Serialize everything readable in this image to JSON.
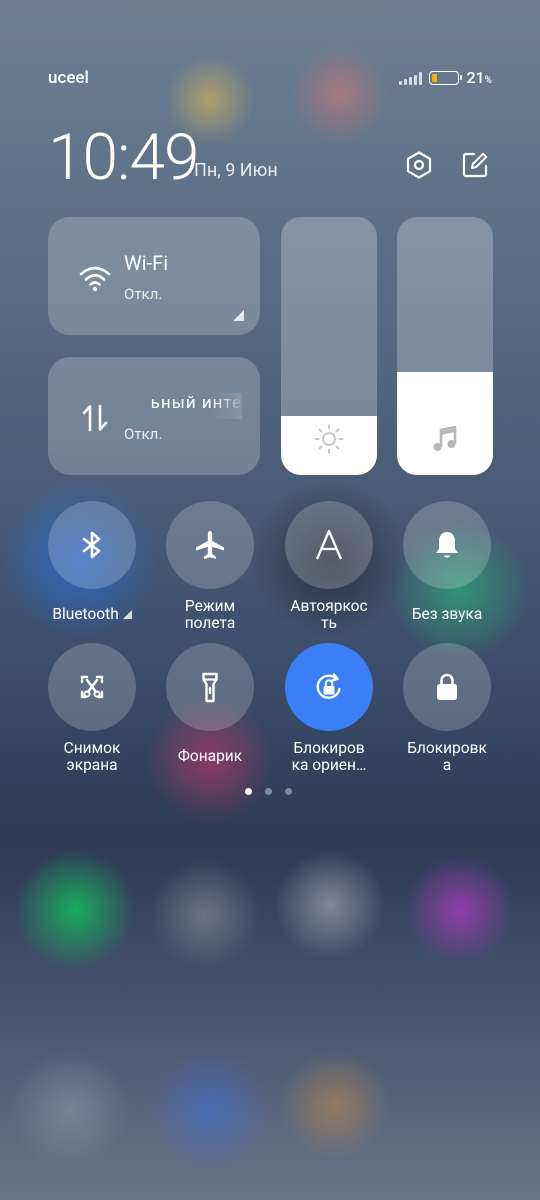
{
  "status_bar": {
    "carrier": "uceel",
    "battery_percent": "21",
    "battery_unit": "%",
    "battery_level": 0.21,
    "battery_color": "#f5b400"
  },
  "header": {
    "time": "10:49",
    "date": "Пн, 9 Июн",
    "icons": [
      "settings-hexagon-icon",
      "edit-icon"
    ]
  },
  "tiles": {
    "wifi": {
      "name": "Wi-Fi",
      "state": "Откл.",
      "icon": "wifi-icon"
    },
    "mobile_data": {
      "name": "ьный инте",
      "state": "Откл.",
      "icon": "data-transfer-icon"
    }
  },
  "sliders": {
    "brightness": {
      "level": 0.23,
      "icon": "sun-icon"
    },
    "volume": {
      "level": 0.4,
      "icon": "music-note-icon"
    }
  },
  "toggles": [
    {
      "label": "Bluetooth",
      "icon": "bluetooth-icon",
      "active": false
    },
    {
      "label": "Режим\nполета",
      "icon": "airplane-icon",
      "active": false
    },
    {
      "label": "Автояркос\nть",
      "icon": "auto-brightness-icon",
      "active": false
    },
    {
      "label": "Без звука",
      "icon": "bell-icon",
      "active": false
    },
    {
      "label": "Снимок\nэкрана",
      "icon": "screenshot-icon",
      "active": false
    },
    {
      "label": "Фонарик",
      "icon": "flashlight-icon",
      "active": false
    },
    {
      "label": "Блокиров\nка ориен…",
      "icon": "rotation-lock-icon",
      "active": true
    },
    {
      "label": "Блокировк\nа",
      "icon": "lock-icon",
      "active": false
    }
  ],
  "pager": {
    "pages": 3,
    "current": 1
  },
  "colors": {
    "accent": "#3b7ff6"
  }
}
